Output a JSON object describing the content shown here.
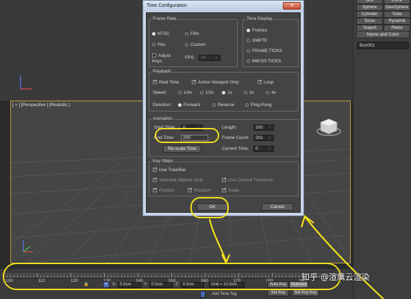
{
  "viewport": {
    "label": "[ + ] [Perspective ] [Realistic ]"
  },
  "command_panel": {
    "primitives": [
      [
        "Box",
        "Cone"
      ],
      [
        "Sphere",
        "GeoSphere"
      ],
      [
        "Cylinder",
        "Tube"
      ],
      [
        "Torus",
        "Pyramid"
      ],
      [
        "Teapot",
        "Plane"
      ]
    ],
    "rollout_title": "Name and Color",
    "object_name": "Box001"
  },
  "dialog": {
    "title": "Time Configuration",
    "frame_rate": {
      "title": "Frame Rate",
      "options": [
        "NTSC",
        "Film",
        "PAL",
        "Custom"
      ],
      "selected": "NTSC",
      "adjust_keys": "Adjust Keys",
      "fps_label": "FPS:",
      "fps_value": "30"
    },
    "time_display": {
      "title": "Time Display",
      "options": [
        "Frames",
        "SMPTE",
        "FRAME:TICKS",
        "MM:SS:TICKS"
      ],
      "selected": "Frames"
    },
    "playback": {
      "title": "Playback",
      "real_time": "Real Time",
      "active_viewport_only": "Active Viewport Only",
      "loop": "Loop",
      "speed_label": "Speed:",
      "speeds": [
        "1/4x",
        "1/2x",
        "1x",
        "2x",
        "4x"
      ],
      "speed_selected": "1x",
      "direction_label": "Direction:",
      "directions": [
        "Forward",
        "Reverse",
        "Ping-Pong"
      ],
      "direction_selected": "Forward"
    },
    "animation": {
      "title": "Animation",
      "start_time_label": "Start Time:",
      "start_time": "0",
      "end_time_label": "End Time:",
      "end_time": "200",
      "length_label": "Length:",
      "length": "200",
      "frame_count_label": "Frame Count:",
      "frame_count": "201",
      "current_time_label": "Current Time:",
      "current_time": "0",
      "rescale_button": "Re-scale Time"
    },
    "key_steps": {
      "title": "Key Steps",
      "use_trackbar": "Use TrackBar",
      "selected_objects_only": "Selected Objects Only",
      "use_current_transform": "Use Current Transform",
      "position": "Position",
      "rotation": "Rotation",
      "scale": "Scale"
    },
    "ok": "OK",
    "cancel": "Cancel"
  },
  "timeline": {
    "ticks": [
      "100",
      "110",
      "120",
      "130",
      "140",
      "150",
      "160",
      "170",
      "180",
      "190"
    ],
    "x_label": "X:",
    "x_value": "0.0cm",
    "y_label": "Y:",
    "y_value": "0.0cm",
    "z_label": "Z:",
    "z_value": "0.0cm",
    "grid": "Grid = 10.0cm",
    "auto_key": "Auto Key",
    "selected": "Selected",
    "set_key": "Set Key",
    "key_filters": "Set Key Key",
    "add_time_tag": "Add Time Tag"
  },
  "watermark": "知乎 @渲鹰云渲染",
  "colors": {
    "highlight": "#f4e21c",
    "viewport_border": "#bfa23a"
  }
}
